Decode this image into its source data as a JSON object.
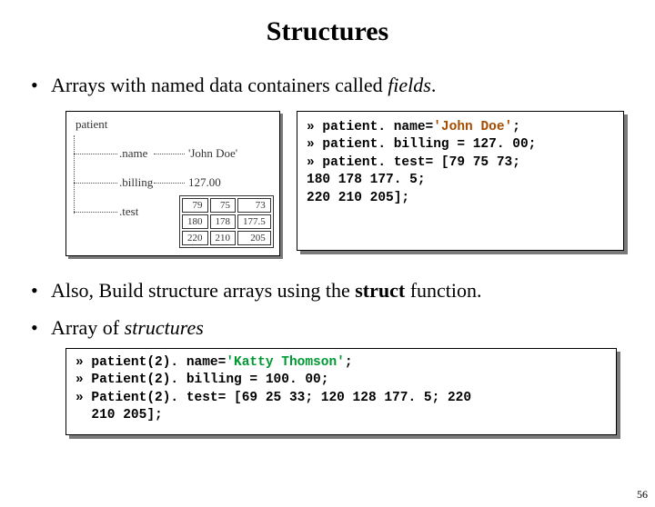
{
  "title": "Structures",
  "bullets": {
    "b1_pre": "Arrays with named data containers called ",
    "b1_em": "fields",
    "b1_post": ".",
    "b2_pre": "Also, Build structure arrays using the ",
    "b2_em": "struct",
    "b2_post": " function.",
    "b3_pre": "Array of ",
    "b3_em": "structures"
  },
  "diagram": {
    "root": "patient",
    "f_name": ".name",
    "f_billing": ".billing",
    "f_test": ".test",
    "v_name": "'John Doe'",
    "v_billing": "127.00",
    "grid": [
      [
        "79",
        "75",
        "73"
      ],
      [
        "180",
        "178",
        "177.5"
      ],
      [
        "220",
        "210",
        "205"
      ]
    ]
  },
  "code1": {
    "l1_a": "» patient. name=",
    "l1_hl": "'John Doe'",
    "l1_b": ";",
    "l2": "» patient. billing = 127. 00;",
    "l3": "» patient. test= [79 75 73;",
    "l4": "180 178 177. 5;",
    "l5": "220 210 205];"
  },
  "code2": {
    "l1_a": "» patient(2). name=",
    "l1_hl": "'Katty Thomson'",
    "l1_b": ";",
    "l2": "» Patient(2). billing = 100. 00;",
    "l3": "» Patient(2). test= [69 25 33; 120 128 177. 5; 220",
    "l4": "  210 205];"
  },
  "page_number": "56"
}
